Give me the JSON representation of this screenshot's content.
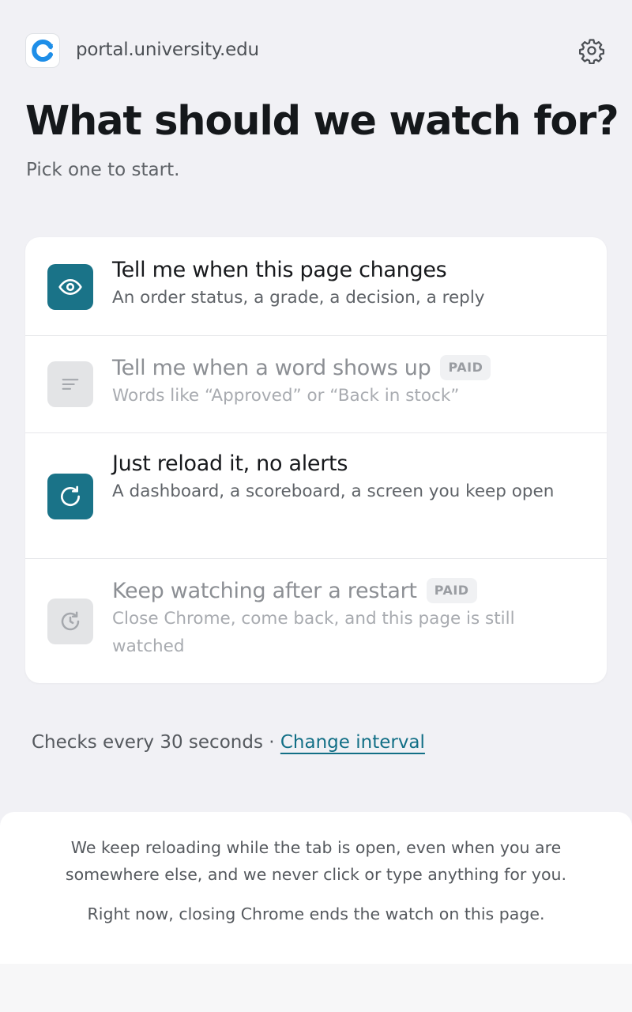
{
  "header": {
    "domain": "portal.university.edu",
    "favicon_icon": "reload-arrow-icon",
    "settings_icon": "gear-icon"
  },
  "title": "What should we watch for?",
  "subtitle": "Pick one to start.",
  "options": [
    {
      "title": "Tell me when this page changes",
      "description": "An order status, a grade, a decision, a reply",
      "icon": "eye-icon",
      "enabled": true,
      "badge": ""
    },
    {
      "title": "Tell me when a word shows up",
      "description": "Words like “Approved” or “Back in stock”",
      "icon": "text-lines-icon",
      "enabled": false,
      "badge": "PAID"
    },
    {
      "title": "Just reload it, no alerts",
      "description": "A dashboard, a scoreboard, a screen you keep open",
      "icon": "refresh-icon",
      "enabled": true,
      "badge": ""
    },
    {
      "title": "Keep watching after a restart",
      "description": "Close Chrome, come back, and this page is still watched",
      "icon": "restart-icon",
      "enabled": false,
      "badge": "PAID"
    }
  ],
  "interval": {
    "text": "Checks every 30 seconds · ",
    "link": "Change interval"
  },
  "info": {
    "line1": "We keep reloading while the tab is open, even when you are somewhere else, and we never click or type anything for you.",
    "line2": "Right now, closing Chrome ends the watch on this page."
  },
  "colors": {
    "accent": "#1a7388",
    "link": "#126f86",
    "background": "#f1f1f5",
    "disabled_icon_bg": "#e3e4e6"
  }
}
